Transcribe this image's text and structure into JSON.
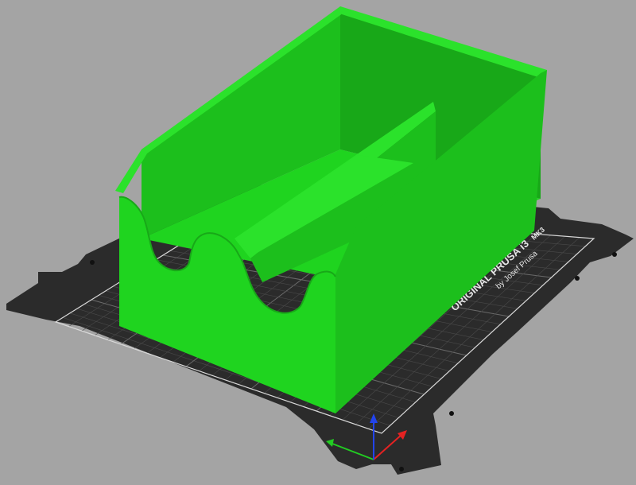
{
  "viewport": {
    "background": "#a4a4a4"
  },
  "bed": {
    "brand_line": "ORIGINAL PRUSA i3",
    "model_suffix": "MK3",
    "byline": "by Josef Prusa",
    "plate_color": "#2b2b2b",
    "grid_color": "#4a4a4a",
    "grid_major_color": "#6a6a6a",
    "border_color": "#d9d9d9"
  },
  "model": {
    "color": "#1fd41f",
    "shade_dark": "#18a818",
    "shade_mid": "#1cbf1c",
    "shade_light": "#2be22b"
  },
  "axes": {
    "x_color": "#e52222",
    "y_color": "#22cc22",
    "z_color": "#2244ee"
  }
}
